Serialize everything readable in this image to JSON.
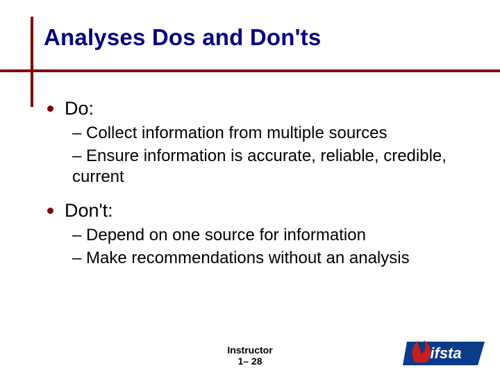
{
  "title": "Analyses Dos and Don'ts",
  "bullets": [
    {
      "label": "Do:",
      "subs": [
        "– Collect information from multiple sources",
        "– Ensure information is accurate, reliable, credible, current"
      ]
    },
    {
      "label": "Don't:",
      "subs": [
        "– Depend on one source for information",
        "– Make recommendations without an analysis"
      ]
    }
  ],
  "footer_line1": "Instructor",
  "footer_line2": "1– 28"
}
